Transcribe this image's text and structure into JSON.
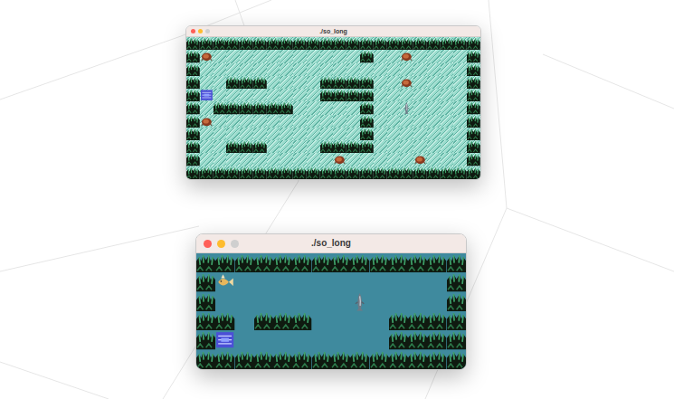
{
  "windows": [
    {
      "title": "./so_long",
      "kind": "pattern",
      "map": [
        "1111111111111111111111",
        "1C00000000000100C00001",
        "1000000000000000000001",
        "1001110000111100C00001",
        "1E00000000111100000001",
        "1011111100000100P00001",
        "1C00000000000100000001",
        "1000000000000100000001",
        "1001110000111100000001",
        "10000000000C00000C0001",
        "1111111111111111111111"
      ]
    },
    {
      "title": "./so_long",
      "kind": "plain",
      "map": [
        "11111111111111",
        "1C000000000001",
        "10000000P00001",
        "11011100001111",
        "1E000000001111",
        "11111111111111"
      ]
    }
  ]
}
